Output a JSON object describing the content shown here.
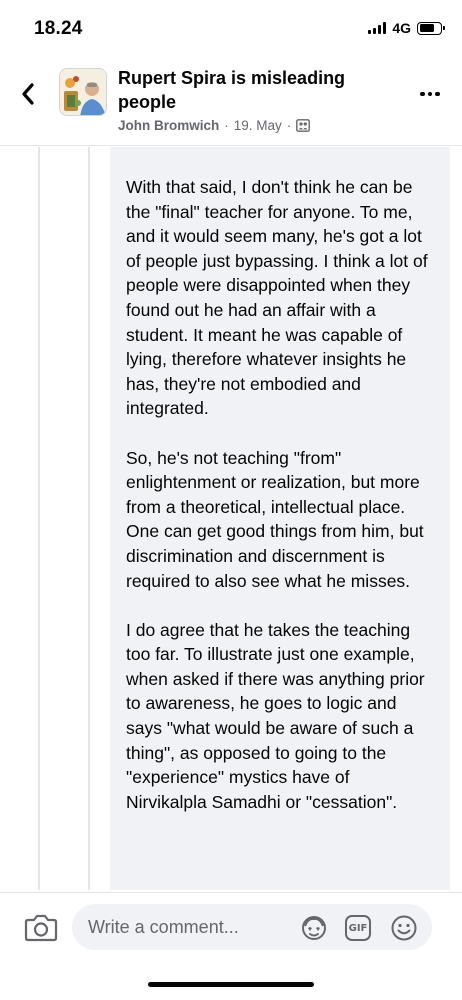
{
  "status_bar": {
    "time": "18.24",
    "network": "4G"
  },
  "header": {
    "back_icon": "chevron-left-icon",
    "title": "Rupert Spira is misleading people",
    "author": "John Bromwich",
    "separator": "·",
    "date": "19. May",
    "audience_icon": "group-audience-icon",
    "more_icon": "more-options-icon"
  },
  "comment": {
    "paragraphs": [
      "With that said, I don't think he can be the \"final\" teacher for anyone. To me, and it would seem many, he's got a lot of people just bypassing. I think a lot of people were disappointed when they found out he had an affair with a student. It meant he was capable of lying, therefore whatever insights he has, they're not embodied and integrated.",
      "So, he's not teaching \"from\" enlightenment or realization, but more from a theoretical, intellectual place. One can get good things from him, but discrimination and discernment is required to also see what he misses.",
      "I do agree that he takes the teaching too far. To illustrate just one example, when asked if there was  anything prior to awareness, he goes to logic and says \"what would be aware of such a thing\", as opposed to going to the \"experience\" mystics have of Nirvikalpla Samadhi or \"cessation\"."
    ]
  },
  "composer": {
    "camera_icon": "camera-icon",
    "placeholder": "Write a comment...",
    "avatar_icon": "avatar-sticker-icon",
    "gif_label": "GIF",
    "emoji_icon": "emoji-icon"
  },
  "colors": {
    "bubble": "#f0f2f5",
    "secondary_text": "#65676b",
    "divider": "#e4e6eb"
  }
}
